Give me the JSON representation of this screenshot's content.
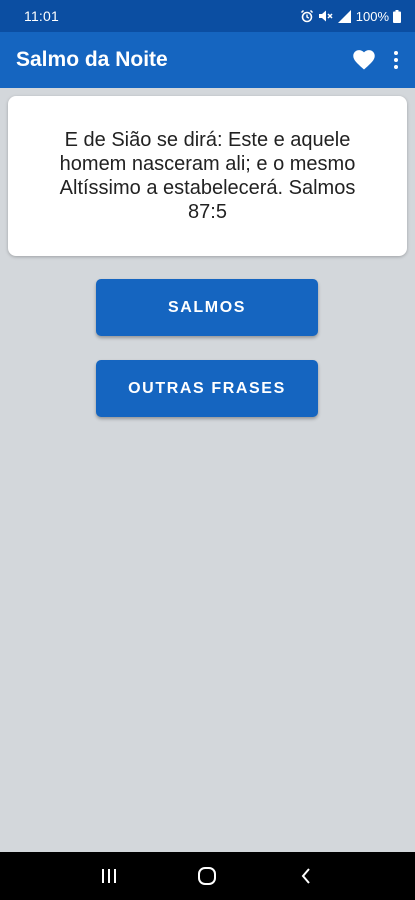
{
  "status_bar": {
    "time": "11:01",
    "battery": "100%",
    "icons": [
      "alarm-icon",
      "mute-icon",
      "signal-icon",
      "battery-icon"
    ]
  },
  "app_bar": {
    "title": "Salmo da Noite",
    "actions": [
      "heart-icon",
      "more-vert-icon"
    ]
  },
  "verse": {
    "text": "E de Sião se dirá: Este e aquele homem nasceram ali; e o mesmo Altíssimo a estabelecerá. Salmos 87:5"
  },
  "buttons": {
    "salmos": "SALMOS",
    "outras_frases": "OUTRAS FRASES"
  },
  "nav_bar": {
    "icons": [
      "recents-icon",
      "home-icon",
      "back-icon"
    ]
  },
  "colors": {
    "status_bar": "#0b4ea2",
    "primary": "#1565c0",
    "background": "#d3d7db",
    "card": "#ffffff"
  }
}
